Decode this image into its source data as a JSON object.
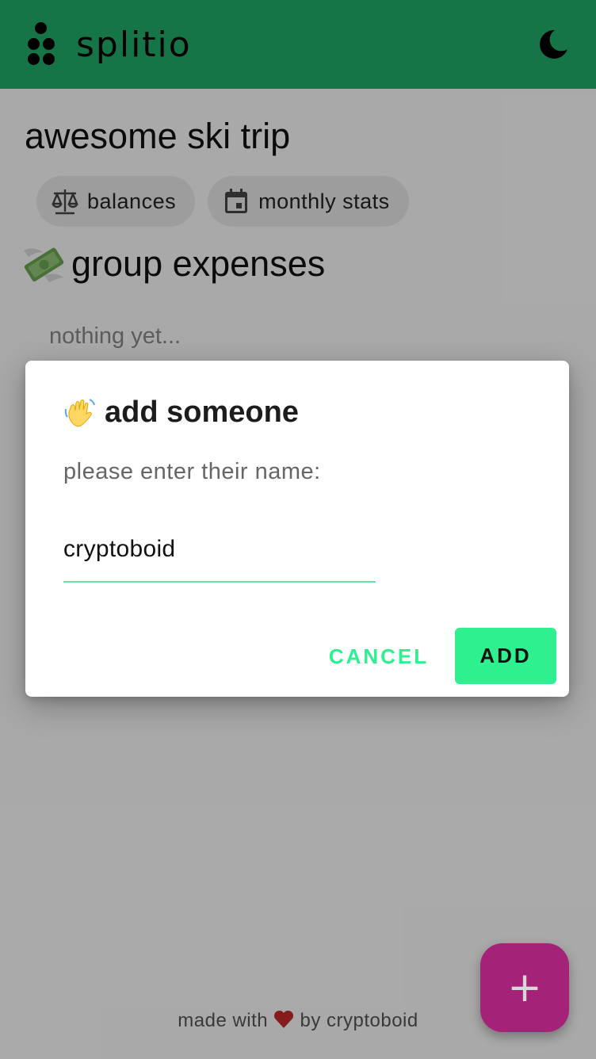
{
  "app": {
    "brand": "splitio",
    "theme_icon": "moon-icon",
    "logo_icon": "splitio-logo-icon"
  },
  "group": {
    "title": "awesome ski trip"
  },
  "chips": [
    {
      "label": "balances",
      "icon": "scale-icon"
    },
    {
      "label": "monthly stats",
      "icon": "calendar-icon"
    }
  ],
  "expenses": {
    "title": "group expenses",
    "emoji": "money-with-wings-emoji",
    "empty": "nothing yet..."
  },
  "dialog": {
    "title": "add someone",
    "emoji": "waving-hand-emoji",
    "prompt": "please enter their name:",
    "input_value": "cryptoboid",
    "cancel_label": "CANCEL",
    "add_label": "ADD"
  },
  "fab": {
    "label": "+"
  },
  "footer": {
    "prefix": "made with",
    "suffix": "by cryptoboid"
  },
  "colors": {
    "appbar": "#21ad68",
    "accent": "#2ef08f",
    "fab": "#a42278",
    "heart": "#c62828"
  }
}
